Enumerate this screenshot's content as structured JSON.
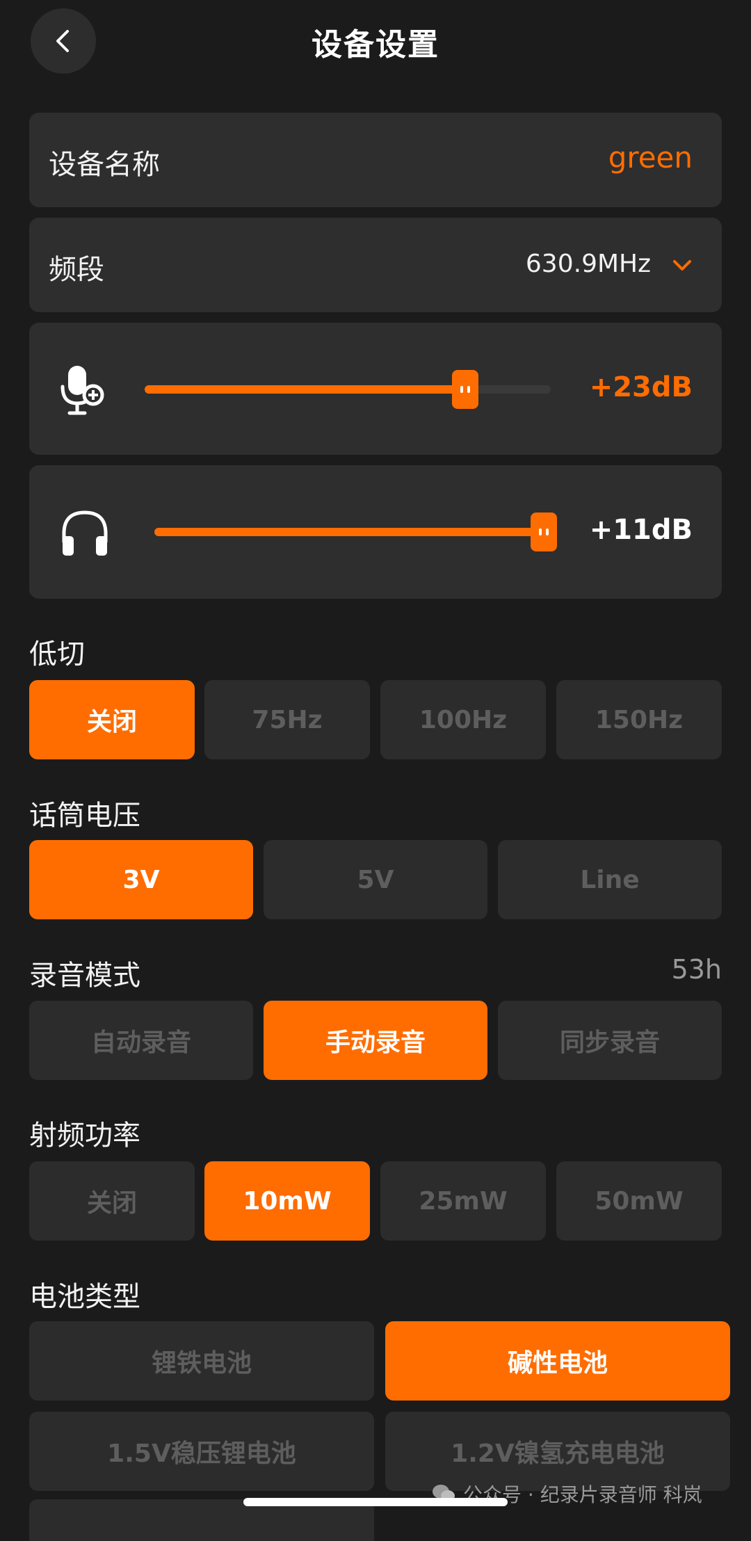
{
  "header": {
    "title": "设备设置"
  },
  "device_name": {
    "label": "设备名称",
    "value": "green"
  },
  "band": {
    "label": "频段",
    "value": "630.9MHz"
  },
  "mic_gain": {
    "value_label": "+23dB",
    "fraction": 0.79
  },
  "headphone_volume": {
    "value_label": "+11dB",
    "fraction": 1.0
  },
  "low_cut": {
    "label": "低切",
    "options": [
      "关闭",
      "75Hz",
      "100Hz",
      "150Hz"
    ],
    "selected": "关闭"
  },
  "mic_voltage": {
    "label": "话筒电压",
    "options": [
      "3V",
      "5V",
      "Line"
    ],
    "selected": "3V"
  },
  "record_mode": {
    "label": "录音模式",
    "remaining": "53h",
    "options": [
      "自动录音",
      "手动录音",
      "同步录音"
    ],
    "selected": "手动录音"
  },
  "rf_power": {
    "label": "射频功率",
    "options": [
      "关闭",
      "10mW",
      "25mW",
      "50mW"
    ],
    "selected": "10mW"
  },
  "battery_type": {
    "label": "电池类型",
    "options": [
      "锂铁电池",
      "碱性电池",
      "1.5V稳压锂电池",
      "1.2V镍氢充电电池"
    ],
    "selected": "碱性电池"
  },
  "watermark": "公众号 · 纪录片录音师 科岚",
  "colors": {
    "accent": "#ff6d00",
    "background": "#1b1b1b",
    "card": "#2e2e2e",
    "inactive_text": "#5e5e5e"
  }
}
